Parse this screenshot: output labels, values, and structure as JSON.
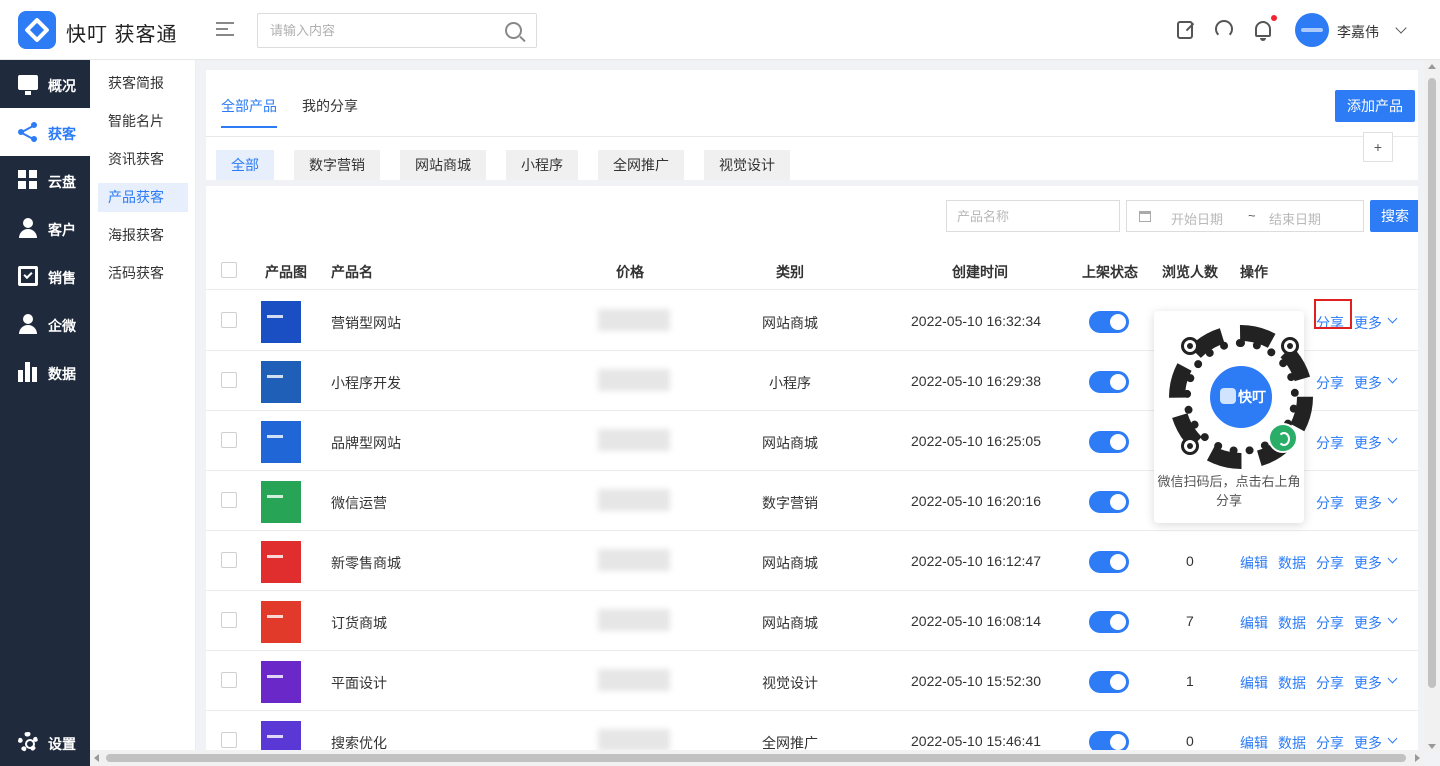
{
  "header": {
    "app_name": "快叮 获客通",
    "search_placeholder": "请输入内容",
    "user_name": "李嘉伟",
    "icons": [
      "edit-icon",
      "headset-icon",
      "bell-icon"
    ]
  },
  "leftnav": {
    "items": [
      {
        "label": "概况",
        "icon": "monitor-icon",
        "active": false
      },
      {
        "label": "获客",
        "icon": "share-icon",
        "active": true
      },
      {
        "label": "云盘",
        "icon": "grid-icon",
        "active": false
      },
      {
        "label": "客户",
        "icon": "user-icon",
        "active": false
      },
      {
        "label": "销售",
        "icon": "clipboard-icon",
        "active": false
      },
      {
        "label": "企微",
        "icon": "user-icon",
        "active": false
      },
      {
        "label": "数据",
        "icon": "bar-chart-icon",
        "active": false
      }
    ],
    "settings_label": "设置"
  },
  "subnav": {
    "items": [
      "获客简报",
      "智能名片",
      "资讯获客",
      "产品获客",
      "海报获客",
      "活码获客"
    ],
    "active_index": 3
  },
  "tabs": {
    "all": "全部产品",
    "mine": "我的分享",
    "add_button": "添加产品"
  },
  "categories": [
    "全部",
    "数字营销",
    "网站商城",
    "小程序",
    "全网推广",
    "视觉设计"
  ],
  "plus_label": "+",
  "filters": {
    "name_placeholder": "产品名称",
    "start_placeholder": "开始日期",
    "separator": "~",
    "end_placeholder": "结束日期",
    "search_button": "搜索"
  },
  "table": {
    "columns": {
      "image": "产品图",
      "name": "产品名",
      "price": "价格",
      "category": "类别",
      "created": "创建时间",
      "status": "上架状态",
      "views": "浏览人数",
      "actions": "操作"
    },
    "action_labels": {
      "edit": "编辑",
      "data": "数据",
      "share": "分享",
      "more": "更多"
    },
    "rows": [
      {
        "name": "营销型网站",
        "category": "网站商城",
        "created": "2022-05-10 16:32:34",
        "views": "",
        "thumb_color": "#1a4fc4"
      },
      {
        "name": "小程序开发",
        "category": "小程序",
        "created": "2022-05-10 16:29:38",
        "views": "",
        "thumb_color": "#1f5fb8"
      },
      {
        "name": "品牌型网站",
        "category": "网站商城",
        "created": "2022-05-10 16:25:05",
        "views": "",
        "thumb_color": "#2066d6"
      },
      {
        "name": "微信运营",
        "category": "数字营销",
        "created": "2022-05-10 16:20:16",
        "views": "",
        "thumb_color": "#27a456"
      },
      {
        "name": "新零售商城",
        "category": "网站商城",
        "created": "2022-05-10 16:12:47",
        "views": "0",
        "thumb_color": "#e02d2d"
      },
      {
        "name": "订货商城",
        "category": "网站商城",
        "created": "2022-05-10 16:08:14",
        "views": "7",
        "thumb_color": "#e23a2a"
      },
      {
        "name": "平面设计",
        "category": "视觉设计",
        "created": "2022-05-10 15:52:30",
        "views": "1",
        "thumb_color": "#6b28c9"
      },
      {
        "name": "搜索优化",
        "category": "全网推广",
        "created": "2022-05-10 15:46:41",
        "views": "0",
        "thumb_color": "#5a38d6"
      }
    ]
  },
  "qr_popover": {
    "brand": "快叮",
    "tip": "微信扫码后，点击右上角分享"
  }
}
